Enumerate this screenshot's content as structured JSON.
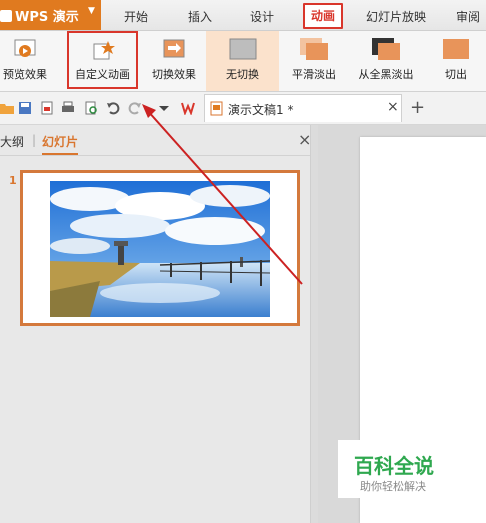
{
  "app": {
    "name": "WPS 演示"
  },
  "menu": {
    "items": [
      "开始",
      "插入",
      "设计",
      "动画",
      "幻灯片放映",
      "审阅"
    ]
  },
  "ribbon": {
    "buttons": [
      "预览效果",
      "自定义动画",
      "切换效果",
      "无切换",
      "平滑淡出",
      "从全黑淡出",
      "切出"
    ]
  },
  "document_tab": {
    "title": "演示文稿1 *"
  },
  "left_pane": {
    "tabs": [
      "大纲",
      "幻灯片"
    ],
    "slide_number": "1"
  },
  "watermark": {
    "title": "百科全说",
    "subtitle": "助你轻松解决"
  },
  "colors": {
    "accent": "#e07a1f",
    "highlight_box": "#d9362b",
    "selected_border": "#d4793c",
    "arrow": "#cc2222"
  }
}
